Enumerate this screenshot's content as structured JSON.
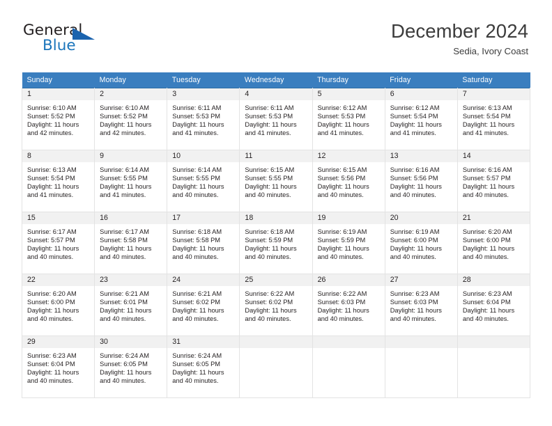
{
  "brand": {
    "name_part1": "General",
    "name_part2": "Blue",
    "logo_icon": "triangle-flag-icon",
    "accent_color": "#1b75bb"
  },
  "header": {
    "title": "December 2024",
    "subtitle": "Sedia, Ivory Coast"
  },
  "theme": {
    "header_row_bg": "#3a7ebf",
    "day_band_bg": "#f1f1f1",
    "cell_border": "#e3e3e3",
    "row_top_border": "#2b6ca3",
    "text": "#231f20"
  },
  "weekday_headers": [
    "Sunday",
    "Monday",
    "Tuesday",
    "Wednesday",
    "Thursday",
    "Friday",
    "Saturday"
  ],
  "weeks": [
    [
      {
        "day": "1",
        "sunrise": "Sunrise: 6:10 AM",
        "sunset": "Sunset: 5:52 PM",
        "daylight_line1": "Daylight: 11 hours",
        "daylight_line2": "and 42 minutes."
      },
      {
        "day": "2",
        "sunrise": "Sunrise: 6:10 AM",
        "sunset": "Sunset: 5:52 PM",
        "daylight_line1": "Daylight: 11 hours",
        "daylight_line2": "and 42 minutes."
      },
      {
        "day": "3",
        "sunrise": "Sunrise: 6:11 AM",
        "sunset": "Sunset: 5:53 PM",
        "daylight_line1": "Daylight: 11 hours",
        "daylight_line2": "and 41 minutes."
      },
      {
        "day": "4",
        "sunrise": "Sunrise: 6:11 AM",
        "sunset": "Sunset: 5:53 PM",
        "daylight_line1": "Daylight: 11 hours",
        "daylight_line2": "and 41 minutes."
      },
      {
        "day": "5",
        "sunrise": "Sunrise: 6:12 AM",
        "sunset": "Sunset: 5:53 PM",
        "daylight_line1": "Daylight: 11 hours",
        "daylight_line2": "and 41 minutes."
      },
      {
        "day": "6",
        "sunrise": "Sunrise: 6:12 AM",
        "sunset": "Sunset: 5:54 PM",
        "daylight_line1": "Daylight: 11 hours",
        "daylight_line2": "and 41 minutes."
      },
      {
        "day": "7",
        "sunrise": "Sunrise: 6:13 AM",
        "sunset": "Sunset: 5:54 PM",
        "daylight_line1": "Daylight: 11 hours",
        "daylight_line2": "and 41 minutes."
      }
    ],
    [
      {
        "day": "8",
        "sunrise": "Sunrise: 6:13 AM",
        "sunset": "Sunset: 5:54 PM",
        "daylight_line1": "Daylight: 11 hours",
        "daylight_line2": "and 41 minutes."
      },
      {
        "day": "9",
        "sunrise": "Sunrise: 6:14 AM",
        "sunset": "Sunset: 5:55 PM",
        "daylight_line1": "Daylight: 11 hours",
        "daylight_line2": "and 41 minutes."
      },
      {
        "day": "10",
        "sunrise": "Sunrise: 6:14 AM",
        "sunset": "Sunset: 5:55 PM",
        "daylight_line1": "Daylight: 11 hours",
        "daylight_line2": "and 40 minutes."
      },
      {
        "day": "11",
        "sunrise": "Sunrise: 6:15 AM",
        "sunset": "Sunset: 5:55 PM",
        "daylight_line1": "Daylight: 11 hours",
        "daylight_line2": "and 40 minutes."
      },
      {
        "day": "12",
        "sunrise": "Sunrise: 6:15 AM",
        "sunset": "Sunset: 5:56 PM",
        "daylight_line1": "Daylight: 11 hours",
        "daylight_line2": "and 40 minutes."
      },
      {
        "day": "13",
        "sunrise": "Sunrise: 6:16 AM",
        "sunset": "Sunset: 5:56 PM",
        "daylight_line1": "Daylight: 11 hours",
        "daylight_line2": "and 40 minutes."
      },
      {
        "day": "14",
        "sunrise": "Sunrise: 6:16 AM",
        "sunset": "Sunset: 5:57 PM",
        "daylight_line1": "Daylight: 11 hours",
        "daylight_line2": "and 40 minutes."
      }
    ],
    [
      {
        "day": "15",
        "sunrise": "Sunrise: 6:17 AM",
        "sunset": "Sunset: 5:57 PM",
        "daylight_line1": "Daylight: 11 hours",
        "daylight_line2": "and 40 minutes."
      },
      {
        "day": "16",
        "sunrise": "Sunrise: 6:17 AM",
        "sunset": "Sunset: 5:58 PM",
        "daylight_line1": "Daylight: 11 hours",
        "daylight_line2": "and 40 minutes."
      },
      {
        "day": "17",
        "sunrise": "Sunrise: 6:18 AM",
        "sunset": "Sunset: 5:58 PM",
        "daylight_line1": "Daylight: 11 hours",
        "daylight_line2": "and 40 minutes."
      },
      {
        "day": "18",
        "sunrise": "Sunrise: 6:18 AM",
        "sunset": "Sunset: 5:59 PM",
        "daylight_line1": "Daylight: 11 hours",
        "daylight_line2": "and 40 minutes."
      },
      {
        "day": "19",
        "sunrise": "Sunrise: 6:19 AM",
        "sunset": "Sunset: 5:59 PM",
        "daylight_line1": "Daylight: 11 hours",
        "daylight_line2": "and 40 minutes."
      },
      {
        "day": "20",
        "sunrise": "Sunrise: 6:19 AM",
        "sunset": "Sunset: 6:00 PM",
        "daylight_line1": "Daylight: 11 hours",
        "daylight_line2": "and 40 minutes."
      },
      {
        "day": "21",
        "sunrise": "Sunrise: 6:20 AM",
        "sunset": "Sunset: 6:00 PM",
        "daylight_line1": "Daylight: 11 hours",
        "daylight_line2": "and 40 minutes."
      }
    ],
    [
      {
        "day": "22",
        "sunrise": "Sunrise: 6:20 AM",
        "sunset": "Sunset: 6:00 PM",
        "daylight_line1": "Daylight: 11 hours",
        "daylight_line2": "and 40 minutes."
      },
      {
        "day": "23",
        "sunrise": "Sunrise: 6:21 AM",
        "sunset": "Sunset: 6:01 PM",
        "daylight_line1": "Daylight: 11 hours",
        "daylight_line2": "and 40 minutes."
      },
      {
        "day": "24",
        "sunrise": "Sunrise: 6:21 AM",
        "sunset": "Sunset: 6:02 PM",
        "daylight_line1": "Daylight: 11 hours",
        "daylight_line2": "and 40 minutes."
      },
      {
        "day": "25",
        "sunrise": "Sunrise: 6:22 AM",
        "sunset": "Sunset: 6:02 PM",
        "daylight_line1": "Daylight: 11 hours",
        "daylight_line2": "and 40 minutes."
      },
      {
        "day": "26",
        "sunrise": "Sunrise: 6:22 AM",
        "sunset": "Sunset: 6:03 PM",
        "daylight_line1": "Daylight: 11 hours",
        "daylight_line2": "and 40 minutes."
      },
      {
        "day": "27",
        "sunrise": "Sunrise: 6:23 AM",
        "sunset": "Sunset: 6:03 PM",
        "daylight_line1": "Daylight: 11 hours",
        "daylight_line2": "and 40 minutes."
      },
      {
        "day": "28",
        "sunrise": "Sunrise: 6:23 AM",
        "sunset": "Sunset: 6:04 PM",
        "daylight_line1": "Daylight: 11 hours",
        "daylight_line2": "and 40 minutes."
      }
    ],
    [
      {
        "day": "29",
        "sunrise": "Sunrise: 6:23 AM",
        "sunset": "Sunset: 6:04 PM",
        "daylight_line1": "Daylight: 11 hours",
        "daylight_line2": "and 40 minutes."
      },
      {
        "day": "30",
        "sunrise": "Sunrise: 6:24 AM",
        "sunset": "Sunset: 6:05 PM",
        "daylight_line1": "Daylight: 11 hours",
        "daylight_line2": "and 40 minutes."
      },
      {
        "day": "31",
        "sunrise": "Sunrise: 6:24 AM",
        "sunset": "Sunset: 6:05 PM",
        "daylight_line1": "Daylight: 11 hours",
        "daylight_line2": "and 40 minutes."
      },
      {
        "day": "",
        "sunrise": "",
        "sunset": "",
        "daylight_line1": "",
        "daylight_line2": ""
      },
      {
        "day": "",
        "sunrise": "",
        "sunset": "",
        "daylight_line1": "",
        "daylight_line2": ""
      },
      {
        "day": "",
        "sunrise": "",
        "sunset": "",
        "daylight_line1": "",
        "daylight_line2": ""
      },
      {
        "day": "",
        "sunrise": "",
        "sunset": "",
        "daylight_line1": "",
        "daylight_line2": ""
      }
    ]
  ]
}
